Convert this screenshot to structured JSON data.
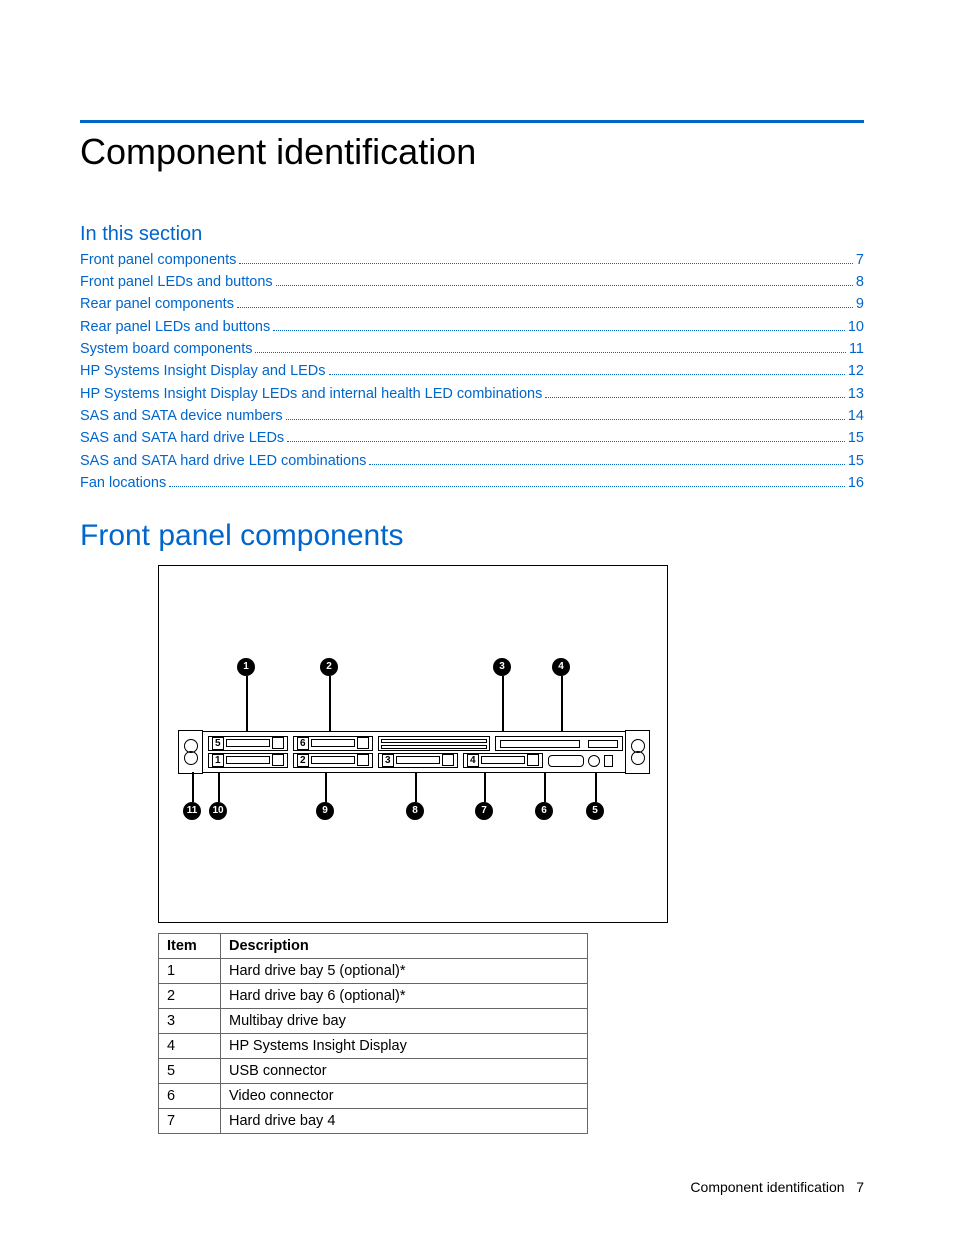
{
  "title": "Component identification",
  "subhead": "In this section",
  "toc": [
    {
      "label": "Front panel components",
      "page": "7"
    },
    {
      "label": "Front panel LEDs and buttons",
      "page": "8"
    },
    {
      "label": "Rear panel components",
      "page": "9"
    },
    {
      "label": "Rear panel LEDs and buttons",
      "page": "10"
    },
    {
      "label": "System board components",
      "page": "11"
    },
    {
      "label": "HP Systems Insight Display and LEDs",
      "page": "12"
    },
    {
      "label": "HP Systems Insight Display LEDs and internal health LED combinations",
      "page": "13"
    },
    {
      "label": "SAS and SATA device numbers",
      "page": "14"
    },
    {
      "label": "SAS and SATA hard drive LEDs",
      "page": "15"
    },
    {
      "label": "SAS and SATA hard drive LED combinations",
      "page": "15"
    },
    {
      "label": "Fan locations",
      "page": "16"
    }
  ],
  "section_heading": "Front panel components",
  "callouts_top": [
    "1",
    "2",
    "3",
    "4"
  ],
  "callouts_bottom": [
    "11",
    "10",
    "9",
    "8",
    "7",
    "6",
    "5"
  ],
  "bay_numbers": {
    "top_left": "5",
    "top_mid": "6",
    "bot_left": "1",
    "bot_mid": "2",
    "bot_3": "3",
    "bot_4": "4"
  },
  "table": {
    "headers": {
      "item": "Item",
      "desc": "Description"
    },
    "rows": [
      {
        "item": "1",
        "desc": "Hard drive bay 5 (optional)*"
      },
      {
        "item": "2",
        "desc": "Hard drive bay 6 (optional)*"
      },
      {
        "item": "3",
        "desc": "Multibay drive bay"
      },
      {
        "item": "4",
        "desc": "HP Systems Insight Display"
      },
      {
        "item": "5",
        "desc": "USB connector"
      },
      {
        "item": "6",
        "desc": "Video connector"
      },
      {
        "item": "7",
        "desc": "Hard drive bay 4"
      }
    ]
  },
  "footer": {
    "text": "Component identification",
    "page": "7"
  }
}
